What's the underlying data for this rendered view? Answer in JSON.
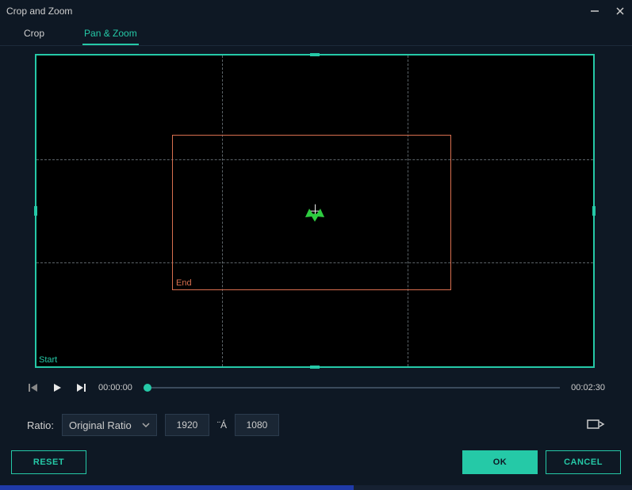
{
  "window": {
    "title": "Crop and Zoom"
  },
  "tabs": {
    "crop": "Crop",
    "panzoom": "Pan & Zoom"
  },
  "stage": {
    "start_label": "Start",
    "end_label": "End"
  },
  "playback": {
    "current": "00:00:00",
    "total": "00:02:30"
  },
  "ratio": {
    "label": "Ratio:",
    "selected": "Original Ratio",
    "width": "1920",
    "times_glyph": "¨Á",
    "height": "1080"
  },
  "buttons": {
    "reset": "RESET",
    "ok": "OK",
    "cancel": "CANCEL"
  },
  "colors": {
    "accent": "#25c9a7",
    "end_rect": "#d96f4f"
  }
}
